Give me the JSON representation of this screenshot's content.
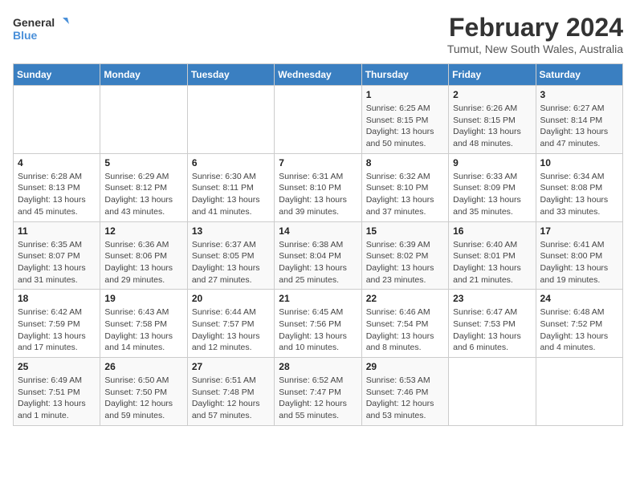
{
  "logo": {
    "line1": "General",
    "line2": "Blue"
  },
  "title": "February 2024",
  "location": "Tumut, New South Wales, Australia",
  "weekdays": [
    "Sunday",
    "Monday",
    "Tuesday",
    "Wednesday",
    "Thursday",
    "Friday",
    "Saturday"
  ],
  "weeks": [
    [
      {
        "day": "",
        "info": ""
      },
      {
        "day": "",
        "info": ""
      },
      {
        "day": "",
        "info": ""
      },
      {
        "day": "",
        "info": ""
      },
      {
        "day": "1",
        "info": "Sunrise: 6:25 AM\nSunset: 8:15 PM\nDaylight: 13 hours\nand 50 minutes."
      },
      {
        "day": "2",
        "info": "Sunrise: 6:26 AM\nSunset: 8:15 PM\nDaylight: 13 hours\nand 48 minutes."
      },
      {
        "day": "3",
        "info": "Sunrise: 6:27 AM\nSunset: 8:14 PM\nDaylight: 13 hours\nand 47 minutes."
      }
    ],
    [
      {
        "day": "4",
        "info": "Sunrise: 6:28 AM\nSunset: 8:13 PM\nDaylight: 13 hours\nand 45 minutes."
      },
      {
        "day": "5",
        "info": "Sunrise: 6:29 AM\nSunset: 8:12 PM\nDaylight: 13 hours\nand 43 minutes."
      },
      {
        "day": "6",
        "info": "Sunrise: 6:30 AM\nSunset: 8:11 PM\nDaylight: 13 hours\nand 41 minutes."
      },
      {
        "day": "7",
        "info": "Sunrise: 6:31 AM\nSunset: 8:10 PM\nDaylight: 13 hours\nand 39 minutes."
      },
      {
        "day": "8",
        "info": "Sunrise: 6:32 AM\nSunset: 8:10 PM\nDaylight: 13 hours\nand 37 minutes."
      },
      {
        "day": "9",
        "info": "Sunrise: 6:33 AM\nSunset: 8:09 PM\nDaylight: 13 hours\nand 35 minutes."
      },
      {
        "day": "10",
        "info": "Sunrise: 6:34 AM\nSunset: 8:08 PM\nDaylight: 13 hours\nand 33 minutes."
      }
    ],
    [
      {
        "day": "11",
        "info": "Sunrise: 6:35 AM\nSunset: 8:07 PM\nDaylight: 13 hours\nand 31 minutes."
      },
      {
        "day": "12",
        "info": "Sunrise: 6:36 AM\nSunset: 8:06 PM\nDaylight: 13 hours\nand 29 minutes."
      },
      {
        "day": "13",
        "info": "Sunrise: 6:37 AM\nSunset: 8:05 PM\nDaylight: 13 hours\nand 27 minutes."
      },
      {
        "day": "14",
        "info": "Sunrise: 6:38 AM\nSunset: 8:04 PM\nDaylight: 13 hours\nand 25 minutes."
      },
      {
        "day": "15",
        "info": "Sunrise: 6:39 AM\nSunset: 8:02 PM\nDaylight: 13 hours\nand 23 minutes."
      },
      {
        "day": "16",
        "info": "Sunrise: 6:40 AM\nSunset: 8:01 PM\nDaylight: 13 hours\nand 21 minutes."
      },
      {
        "day": "17",
        "info": "Sunrise: 6:41 AM\nSunset: 8:00 PM\nDaylight: 13 hours\nand 19 minutes."
      }
    ],
    [
      {
        "day": "18",
        "info": "Sunrise: 6:42 AM\nSunset: 7:59 PM\nDaylight: 13 hours\nand 17 minutes."
      },
      {
        "day": "19",
        "info": "Sunrise: 6:43 AM\nSunset: 7:58 PM\nDaylight: 13 hours\nand 14 minutes."
      },
      {
        "day": "20",
        "info": "Sunrise: 6:44 AM\nSunset: 7:57 PM\nDaylight: 13 hours\nand 12 minutes."
      },
      {
        "day": "21",
        "info": "Sunrise: 6:45 AM\nSunset: 7:56 PM\nDaylight: 13 hours\nand 10 minutes."
      },
      {
        "day": "22",
        "info": "Sunrise: 6:46 AM\nSunset: 7:54 PM\nDaylight: 13 hours\nand 8 minutes."
      },
      {
        "day": "23",
        "info": "Sunrise: 6:47 AM\nSunset: 7:53 PM\nDaylight: 13 hours\nand 6 minutes."
      },
      {
        "day": "24",
        "info": "Sunrise: 6:48 AM\nSunset: 7:52 PM\nDaylight: 13 hours\nand 4 minutes."
      }
    ],
    [
      {
        "day": "25",
        "info": "Sunrise: 6:49 AM\nSunset: 7:51 PM\nDaylight: 13 hours\nand 1 minute."
      },
      {
        "day": "26",
        "info": "Sunrise: 6:50 AM\nSunset: 7:50 PM\nDaylight: 12 hours\nand 59 minutes."
      },
      {
        "day": "27",
        "info": "Sunrise: 6:51 AM\nSunset: 7:48 PM\nDaylight: 12 hours\nand 57 minutes."
      },
      {
        "day": "28",
        "info": "Sunrise: 6:52 AM\nSunset: 7:47 PM\nDaylight: 12 hours\nand 55 minutes."
      },
      {
        "day": "29",
        "info": "Sunrise: 6:53 AM\nSunset: 7:46 PM\nDaylight: 12 hours\nand 53 minutes."
      },
      {
        "day": "",
        "info": ""
      },
      {
        "day": "",
        "info": ""
      }
    ]
  ]
}
